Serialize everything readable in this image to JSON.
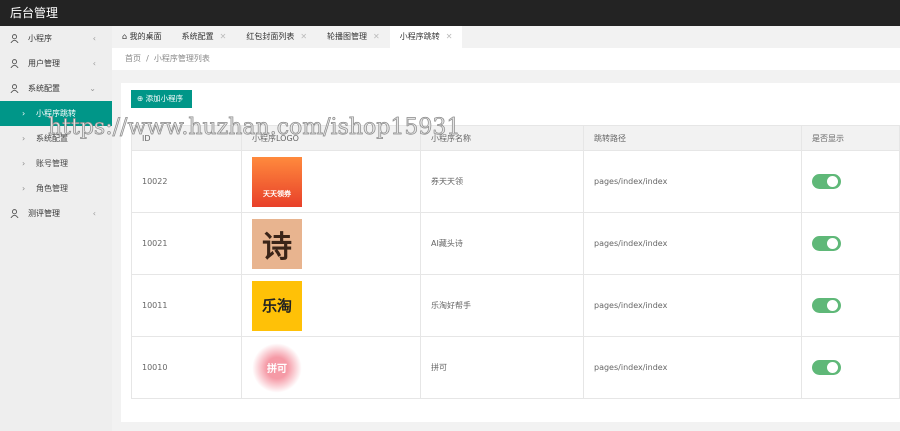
{
  "app": {
    "title": "后台管理"
  },
  "sidebar": {
    "items": [
      {
        "label": "小程序",
        "arrow": "‹"
      },
      {
        "label": "用户管理",
        "arrow": "‹"
      },
      {
        "label": "系统配置",
        "arrow": "⌄"
      }
    ],
    "sub": [
      {
        "label": "小程序跳转"
      },
      {
        "label": "系统配置"
      },
      {
        "label": "账号管理"
      },
      {
        "label": "角色管理"
      }
    ],
    "last": {
      "label": "测评管理",
      "arrow": "‹"
    }
  },
  "tabs": [
    {
      "label": "我的桌面"
    },
    {
      "label": "系统配置"
    },
    {
      "label": "红包封面列表"
    },
    {
      "label": "轮播图管理"
    },
    {
      "label": "小程序跳转"
    }
  ],
  "breadcrumb": {
    "home": "首页",
    "sep": "/",
    "current": "小程序管理列表"
  },
  "toolbar": {
    "add_label": "添加小程序"
  },
  "table": {
    "headers": [
      "ID",
      "小程序LOGO",
      "小程序名称",
      "跳转路径",
      "是否显示"
    ],
    "rows": [
      {
        "id": "10022",
        "logo_text": "天天领券",
        "name": "券天天领",
        "path": "pages/index/index",
        "show": true
      },
      {
        "id": "10021",
        "logo_text": "诗",
        "name": "AI藏头诗",
        "path": "pages/index/index",
        "show": true
      },
      {
        "id": "10011",
        "logo_text": "乐淘",
        "name": "乐淘好帮手",
        "path": "pages/index/index",
        "show": true
      },
      {
        "id": "10010",
        "logo_text": "拼可",
        "name": "拼可",
        "path": "pages/index/index",
        "show": true
      }
    ]
  },
  "watermark": "https://www.huzhan.com/ishop15931",
  "colors": {
    "accent": "#009688",
    "switch": "#5fb878",
    "topbar": "#232323"
  }
}
